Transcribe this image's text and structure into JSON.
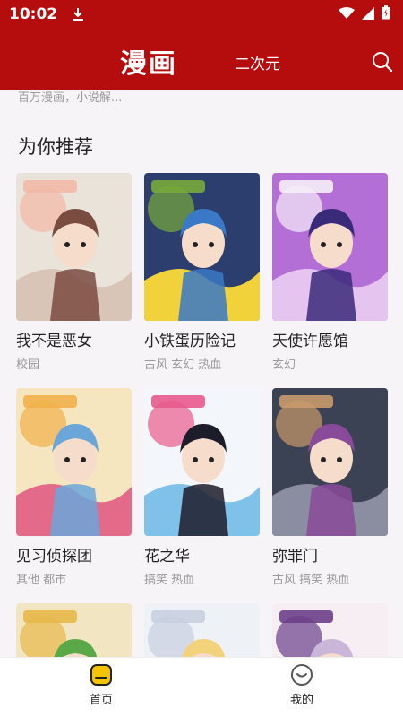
{
  "status_bar": {
    "time": "10:02",
    "icons": [
      "download-icon",
      "wifi-icon",
      "signal-icon",
      "battery-icon"
    ]
  },
  "app_bar": {
    "tab_active": "漫画",
    "tab_other": "二次元",
    "search_icon": "search-icon",
    "bg_color": "#b50d0d"
  },
  "search": {
    "hint": "百万漫画，小说解..."
  },
  "section": {
    "title": "为你推荐"
  },
  "comics": [
    {
      "name": "我不是恶女",
      "tags": "校园",
      "palette": [
        "#e9e3da",
        "#d9c4b8",
        "#7a4b3f",
        "#f2b8a6"
      ]
    },
    {
      "name": "小铁蛋历险记",
      "tags": "古风 玄幻 热血",
      "palette": [
        "#2c3e6d",
        "#f2d23a",
        "#3a79c7",
        "#77aa3a"
      ]
    },
    {
      "name": "天使许愿馆",
      "tags": "玄幻",
      "palette": [
        "#b46fd6",
        "#e6c4f0",
        "#3a2a7a",
        "#f5eef8"
      ]
    },
    {
      "name": "见习侦探团",
      "tags": "其他 都市",
      "palette": [
        "#f6e6c0",
        "#e46a8a",
        "#6aa6d8",
        "#f2b04a"
      ]
    },
    {
      "name": "花之华",
      "tags": "搞笑 热血",
      "palette": [
        "#f3f7fb",
        "#7fc1e8",
        "#1c1c2a",
        "#e85a8c"
      ]
    },
    {
      "name": "弥罪门",
      "tags": "古风 搞笑 热血",
      "palette": [
        "#3b4254",
        "#8b8ea0",
        "#8a4a9a",
        "#c99a6a"
      ]
    },
    {
      "name": "",
      "tags": "",
      "palette": [
        "#f2e6c2",
        "#d8402e",
        "#5aa848",
        "#e8b84a"
      ]
    },
    {
      "name": "",
      "tags": "",
      "palette": [
        "#eef1f6",
        "#2e5aa8",
        "#f2d27a",
        "#c8cfe0"
      ]
    },
    {
      "name": "",
      "tags": "",
      "palette": [
        "#f7eef4",
        "#d96fa2",
        "#c9b6d8",
        "#6a3f8a"
      ]
    }
  ],
  "bottom_nav": {
    "home_label": "首页",
    "home_icon": "home-icon",
    "mine_label": "我的",
    "mine_icon": "profile-icon",
    "active_color": "#f2c500"
  }
}
